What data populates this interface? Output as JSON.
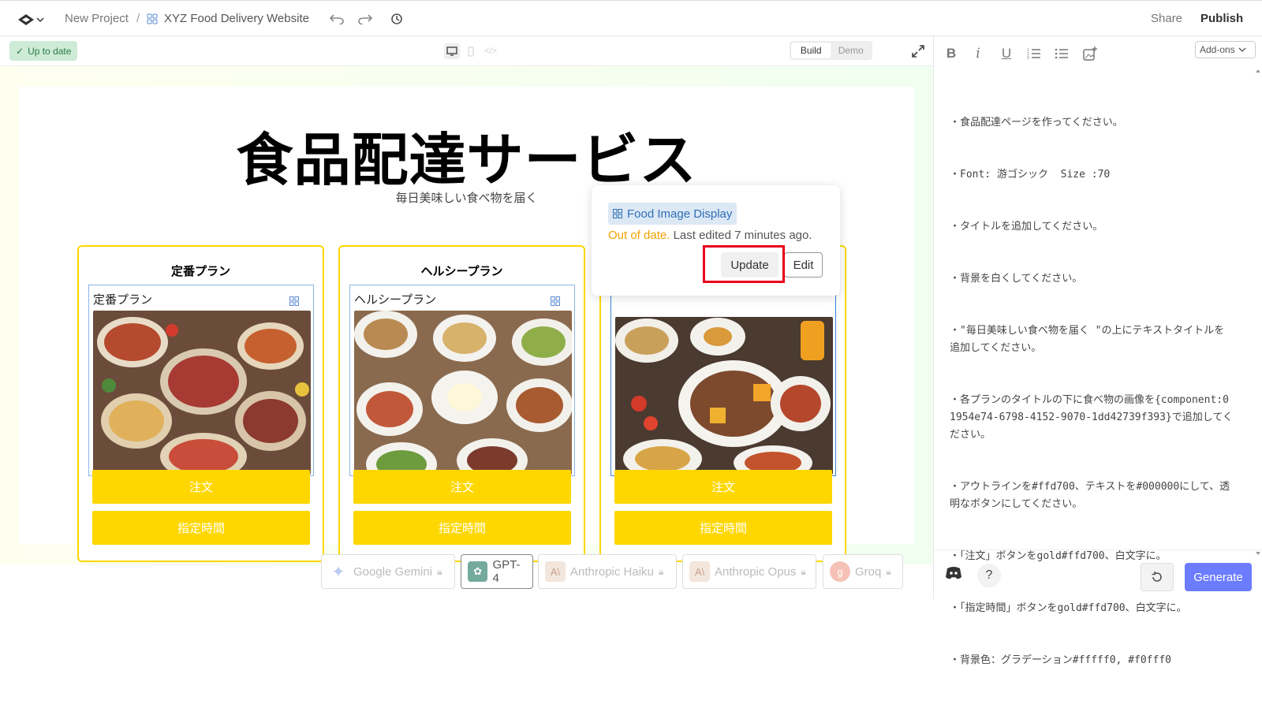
{
  "header": {
    "project": "New Project",
    "separator": "/",
    "file": "XYZ Food Delivery Website",
    "share": "Share",
    "publish": "Publish"
  },
  "toolbar": {
    "status": "Up to date",
    "build": "Build",
    "demo": "Demo"
  },
  "page": {
    "title": "食品配達サービス",
    "subtitle": "毎日美味しい食べ物を届く",
    "cards": [
      {
        "title": "定番プラン",
        "image_label": "定番プラン",
        "order": "注文",
        "time": "指定時間"
      },
      {
        "title": "ヘルシープラン",
        "image_label": "ヘルシープラン",
        "order": "注文",
        "time": "指定時間"
      },
      {
        "title": "",
        "image_label": "",
        "order": "注文",
        "time": "指定時間"
      }
    ],
    "colors": {
      "accent": "#ffd700",
      "bg_from": "#fffff0",
      "bg_to": "#f0fff0"
    }
  },
  "popup": {
    "component": "Food Image Display",
    "out_of_date": "Out of date.",
    "last_edited": "Last edited 7 minutes ago.",
    "update": "Update",
    "edit": "Edit"
  },
  "models": [
    {
      "name": "Google Gemini",
      "locked": true
    },
    {
      "name": "GPT-4",
      "locked": false
    },
    {
      "name": "Anthropic Haiku",
      "locked": true
    },
    {
      "name": "Anthropic Opus",
      "locked": true
    },
    {
      "name": "Groq",
      "locked": true
    }
  ],
  "editor": {
    "addons": "Add-ons",
    "lines": [
      "・食品配達ページを作ってください。",
      "・Font: 游ゴシック  Size :70",
      "・タイトルを追加してください。",
      "・背景を白くしてください。",
      "・\"毎日美味しい食べ物を届く \"の上にテキストタイトルを追加してください。",
      "・各プランのタイトルの下に食べ物の画像を{component:01954e74-6798-4152-9070-1dd42739f393}で追加してください。",
      "・アウトラインを#ffd700、テキストを#000000にして、透明なボタンにしてください。",
      "・「注文」ボタンをgold#ffd700、白文字に。",
      "・「指定時間」ボタンをgold#ffd700、白文字に。",
      "・背景色：グラデーション#fffff0, #f0fff0"
    ],
    "generate": "Generate"
  }
}
